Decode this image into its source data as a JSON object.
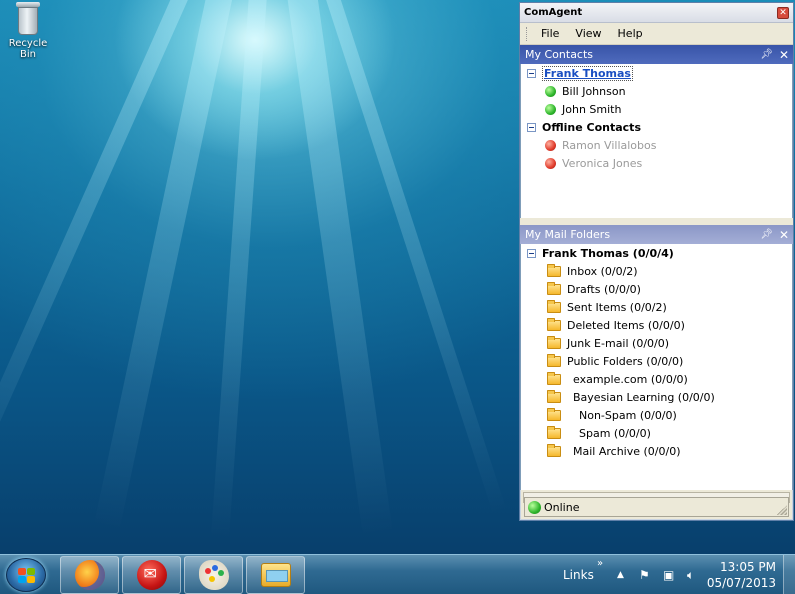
{
  "desktop": {
    "icons": [
      {
        "label": "Recycle Bin",
        "icon": "recycle-bin-icon"
      }
    ]
  },
  "window": {
    "title": "ComAgent",
    "menu": [
      "File",
      "View",
      "Help"
    ],
    "contacts_pane": {
      "title": "My Contacts",
      "groups": [
        {
          "name": "Frank Thomas",
          "selected": true,
          "contacts": [
            {
              "name": "Bill Johnson",
              "status": "online"
            },
            {
              "name": "John Smith",
              "status": "online"
            }
          ]
        },
        {
          "name": "Offline Contacts",
          "selected": false,
          "contacts": [
            {
              "name": "Ramon Villalobos",
              "status": "offline"
            },
            {
              "name": "Veronica Jones",
              "status": "offline"
            }
          ]
        }
      ]
    },
    "folders_pane": {
      "title": "My Mail Folders",
      "account": "Frank Thomas (0/0/4)",
      "folders": [
        {
          "name": "Inbox (0/0/2)"
        },
        {
          "name": "Drafts (0/0/0)"
        },
        {
          "name": "Sent Items (0/0/2)"
        },
        {
          "name": "Deleted Items (0/0/0)"
        },
        {
          "name": "Junk E-mail (0/0/0)"
        },
        {
          "name": "Public Folders (0/0/0)"
        },
        {
          "name": "example.com (0/0/0)"
        },
        {
          "name": "Bayesian Learning (0/0/0)"
        },
        {
          "name": "Non-Spam (0/0/0)"
        },
        {
          "name": "Spam (0/0/0)"
        },
        {
          "name": "Mail Archive (0/0/0)"
        }
      ]
    },
    "status": {
      "text": "Online",
      "state": "online"
    }
  },
  "taskbar": {
    "apps": [
      {
        "name": "Firefox",
        "icon": "firefox-icon"
      },
      {
        "name": "Mail",
        "icon": "mail-icon"
      },
      {
        "name": "Paint",
        "icon": "paint-icon"
      },
      {
        "name": "Windows Explorer",
        "icon": "explorer-icon"
      }
    ],
    "links_label": "Links",
    "clock": {
      "time": "13:05 PM",
      "date": "05/07/2013"
    }
  },
  "colors": {
    "pane_header_active": "#3854a8",
    "pane_header_inactive": "#8b97c7",
    "online": "#2eb52b",
    "offline": "#e03a2a",
    "selected_text": "#1a4fc2"
  }
}
